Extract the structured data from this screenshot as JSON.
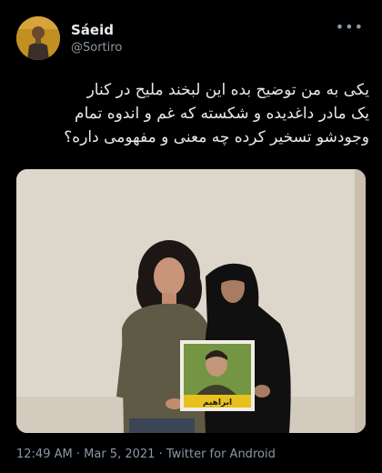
{
  "tweet": {
    "author_name": "Sáeid",
    "author_handle": "@Sortiro",
    "more_icon": "more-dots-icon",
    "text": "یکی به من توضیح بده این لبخند ملیح در کنار\nیک مادر داغدیده و شکسته که غم و اندوه تمام\nوجودشو تسخیر کرده چه معنی و مفهومی داره؟",
    "time": "12:49 AM",
    "date": "Mar 5, 2021",
    "source": "Twitter for Android",
    "separator": "·"
  },
  "photo": {
    "placard_caption": "ابراهیم"
  },
  "colors": {
    "background": "#000000",
    "primary_text": "#e7e9ea",
    "secondary_text": "#8b98a5",
    "avatar_bg": "#b8861c",
    "photo_wall": "#ddd6ca"
  }
}
